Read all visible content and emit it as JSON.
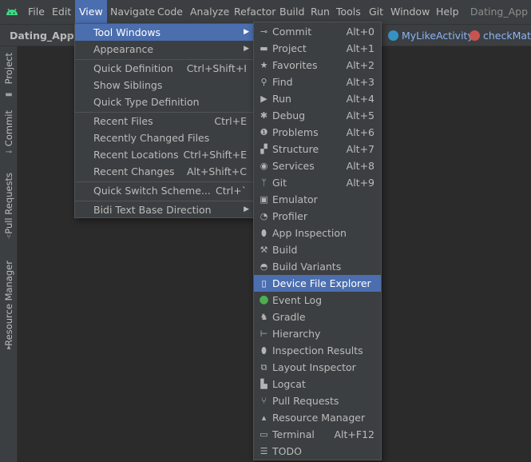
{
  "menubar": {
    "items": [
      "File",
      "Edit",
      "View",
      "Navigate",
      "Code",
      "Analyze",
      "Refactor",
      "Build",
      "Run",
      "Tools",
      "Git",
      "Window",
      "Help"
    ],
    "title": "Dating_App"
  },
  "navbar": {
    "project": "Dating_App",
    "crumb1": "MyLikeActivity",
    "crumb2": "checkMat"
  },
  "toolstrip": {
    "tabs": [
      "Project",
      "Commit",
      "Pull Requests",
      "Resource Manager"
    ]
  },
  "view_menu": {
    "items": [
      {
        "label": "Tool Windows",
        "shortcut": ""
      },
      {
        "label": "Appearance",
        "shortcut": ""
      },
      {
        "label": "Quick Definition",
        "shortcut": "Ctrl+Shift+I"
      },
      {
        "label": "Show Siblings",
        "shortcut": ""
      },
      {
        "label": "Quick Type Definition",
        "shortcut": ""
      },
      {
        "label": "Recent Files",
        "shortcut": "Ctrl+E"
      },
      {
        "label": "Recently Changed Files",
        "shortcut": ""
      },
      {
        "label": "Recent Locations",
        "shortcut": "Ctrl+Shift+E"
      },
      {
        "label": "Recent Changes",
        "shortcut": "Alt+Shift+C"
      },
      {
        "label": "Quick Switch Scheme...",
        "shortcut": "Ctrl+`"
      },
      {
        "label": "Bidi Text Base Direction",
        "shortcut": ""
      }
    ]
  },
  "tool_windows_menu": {
    "items": [
      {
        "label": "Commit",
        "shortcut": "Alt+0",
        "icon": "commit-icon"
      },
      {
        "label": "Project",
        "shortcut": "Alt+1",
        "icon": "folder-icon"
      },
      {
        "label": "Favorites",
        "shortcut": "Alt+2",
        "icon": "star-icon"
      },
      {
        "label": "Find",
        "shortcut": "Alt+3",
        "icon": "search-icon"
      },
      {
        "label": "Run",
        "shortcut": "Alt+4",
        "icon": "run-icon"
      },
      {
        "label": "Debug",
        "shortcut": "Alt+5",
        "icon": "bug-icon"
      },
      {
        "label": "Problems",
        "shortcut": "Alt+6",
        "icon": "problems-icon"
      },
      {
        "label": "Structure",
        "shortcut": "Alt+7",
        "icon": "structure-icon"
      },
      {
        "label": "Services",
        "shortcut": "Alt+8",
        "icon": "services-icon"
      },
      {
        "label": "Git",
        "shortcut": "Alt+9",
        "icon": "git-branch-icon"
      },
      {
        "label": "Emulator",
        "shortcut": "",
        "icon": "emulator-icon"
      },
      {
        "label": "Profiler",
        "shortcut": "",
        "icon": "gauge-icon"
      },
      {
        "label": "App Inspection",
        "shortcut": "",
        "icon": "app-inspection-icon"
      },
      {
        "label": "Build",
        "shortcut": "",
        "icon": "hammer-icon"
      },
      {
        "label": "Build Variants",
        "shortcut": "",
        "icon": "android-icon"
      },
      {
        "label": "Device File Explorer",
        "shortcut": "",
        "icon": "device-icon"
      },
      {
        "label": "Event Log",
        "shortcut": "",
        "icon": "event-log-icon"
      },
      {
        "label": "Gradle",
        "shortcut": "",
        "icon": "gradle-icon"
      },
      {
        "label": "Hierarchy",
        "shortcut": "",
        "icon": "hierarchy-icon"
      },
      {
        "label": "Inspection Results",
        "shortcut": "",
        "icon": "inspection-icon"
      },
      {
        "label": "Layout Inspector",
        "shortcut": "",
        "icon": "layout-inspector-icon"
      },
      {
        "label": "Logcat",
        "shortcut": "",
        "icon": "logcat-icon"
      },
      {
        "label": "Pull Requests",
        "shortcut": "",
        "icon": "pull-request-icon"
      },
      {
        "label": "Resource Manager",
        "shortcut": "",
        "icon": "resource-manager-icon"
      },
      {
        "label": "Terminal",
        "shortcut": "Alt+F12",
        "icon": "terminal-icon"
      },
      {
        "label": "TODO",
        "shortcut": "",
        "icon": "todo-icon"
      }
    ]
  },
  "colors": {
    "selection": "#4b6eaf",
    "menu_bg": "#3c3f41",
    "editor_bg": "#2b2b2b",
    "android_green": "#3ddc84",
    "event_log_green": "#4caf50"
  }
}
